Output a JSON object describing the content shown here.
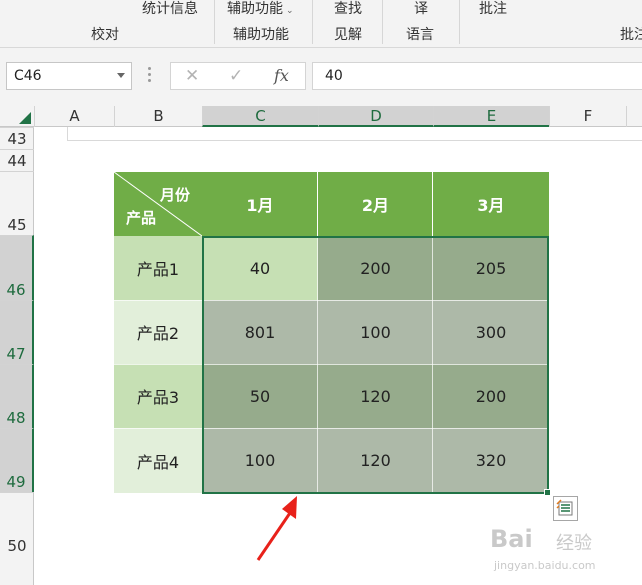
{
  "ribbon": {
    "items": [
      "统计信息",
      "辅助功能",
      "查找",
      "译",
      "批注",
      "校对",
      "辅助功能",
      "见解",
      "语言",
      "批注"
    ]
  },
  "formula_bar": {
    "name_box": "C46",
    "cancel_glyph": "✕",
    "enter_glyph": "✓",
    "fx_label": "fx",
    "formula": "40"
  },
  "columns": [
    "A",
    "B",
    "C",
    "D",
    "E",
    "F"
  ],
  "rows": [
    "43",
    "44",
    "45",
    "46",
    "47",
    "48",
    "49",
    "50"
  ],
  "table": {
    "corner_top": "月份",
    "corner_bottom": "产品",
    "months": [
      "1月",
      "2月",
      "3月"
    ],
    "products": [
      "产品1",
      "产品2",
      "产品3",
      "产品4"
    ],
    "values": [
      [
        "40",
        "200",
        "205"
      ],
      [
        "801",
        "100",
        "300"
      ],
      [
        "50",
        "120",
        "200"
      ],
      [
        "100",
        "120",
        "320"
      ]
    ],
    "colors": {
      "header": "#70ad47",
      "product_odd": "#c6e0b4",
      "product_even": "#e2efda",
      "active_cell": "#c6e0b4",
      "selected_dark": "#96ab8c",
      "selected_light": "#adb9a8",
      "selection_border": "#217346"
    }
  },
  "watermark": {
    "brand": "Bai",
    "jingyan": "经验",
    "url": "jingyan.baidu.com"
  },
  "icons": [
    "dropdown-icon",
    "cancel-icon",
    "enter-icon",
    "fx-icon",
    "select-all-icon",
    "quick-analysis-icon",
    "red-arrow"
  ]
}
